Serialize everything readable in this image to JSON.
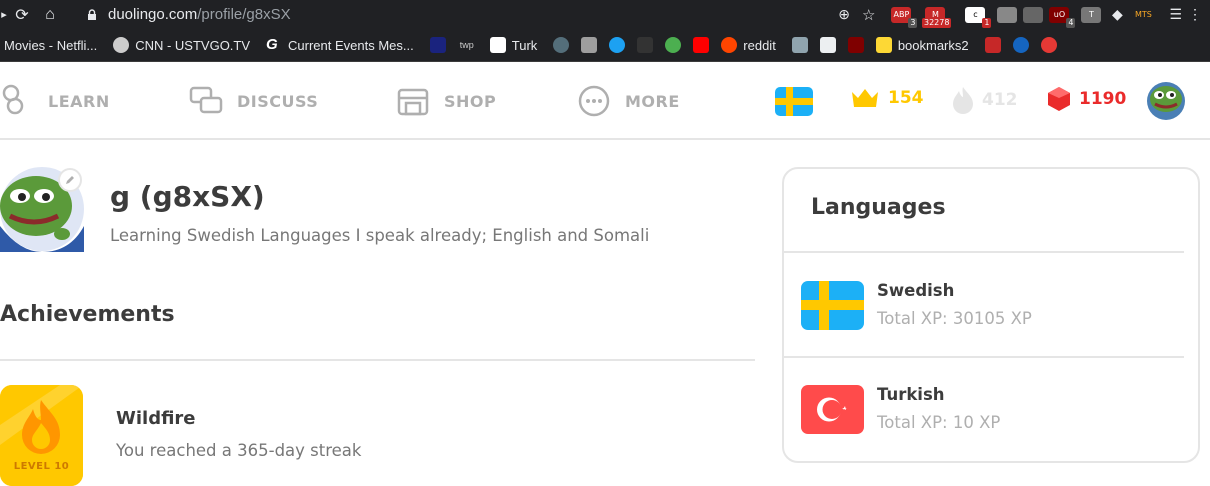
{
  "browser": {
    "url_domain": "duolingo.com",
    "url_path": "/profile/g8xSX",
    "extensions": [
      {
        "name": "abp",
        "label": "ABP",
        "badge": "3"
      },
      {
        "name": "gmail",
        "label": "M",
        "badge": "32278"
      },
      {
        "name": "ext3",
        "label": "c",
        "badge": "1"
      },
      {
        "name": "ext4",
        "label": "",
        "badge": ""
      },
      {
        "name": "ext5",
        "label": "",
        "badge": ""
      },
      {
        "name": "ublock",
        "label": "uO",
        "badge": "4"
      },
      {
        "name": "ext7",
        "label": "T",
        "badge": ""
      },
      {
        "name": "ext8",
        "label": "",
        "badge": ""
      },
      {
        "name": "mts",
        "label": "MTS",
        "badge": ""
      }
    ],
    "bookmarks": [
      "Movies - Netfli...",
      "CNN - USTVGO.TV",
      "Current Events Mes...",
      "Turk",
      "reddit",
      "bookmarks2"
    ]
  },
  "nav": {
    "learn": "LEARN",
    "discuss": "DISCUSS",
    "shop": "SHOP",
    "more": "MORE",
    "crowns": "154",
    "streak": "412",
    "gems": "1190"
  },
  "colors": {
    "crown": "#ffc800",
    "streak_inactive": "#e5e5e5",
    "gems": "#ea2b2b",
    "swedish_blue": "#1cb0f6",
    "swedish_yellow": "#ffc800",
    "turkey_red": "#ff4b4b"
  },
  "profile": {
    "username": "g (g8xSX)",
    "learning": "Learning Swedish Languages I speak already; English and Somali"
  },
  "achievements": {
    "title": "Achievements",
    "items": [
      {
        "name": "Wildfire",
        "desc": "You reached a 365-day streak",
        "level": "LEVEL 10"
      }
    ]
  },
  "languages": {
    "title": "Languages",
    "items": [
      {
        "name": "Swedish",
        "xp": "Total XP: 30105 XP"
      },
      {
        "name": "Turkish",
        "xp": "Total XP: 10 XP"
      }
    ]
  }
}
